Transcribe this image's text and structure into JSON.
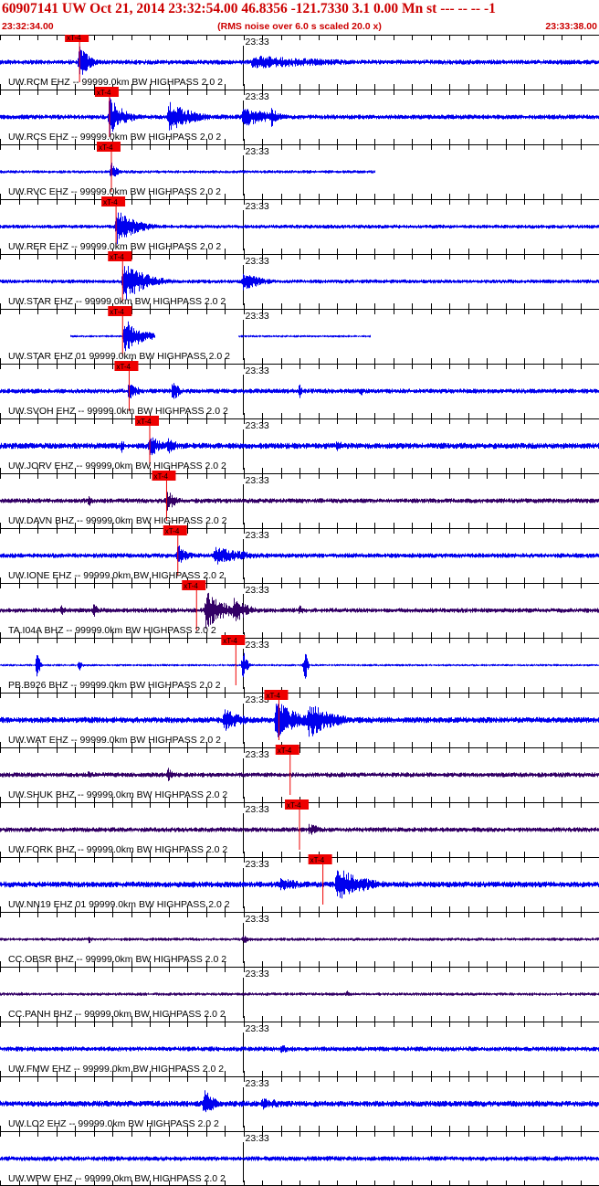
{
  "header": {
    "title": "60907141 UW Oct 21, 2014 23:32:54.00   46.8356 -121.7330  3.1 0.00 Mn st --- -- --   -1",
    "start_time": "23:32:34.00",
    "note": "(RMS noise over 6.0 s scaled 20.0 x)",
    "end_time": "23:33:38.00"
  },
  "colors": {
    "header_text": "#cc0000",
    "trace_blue": "#0000ee",
    "trace_purple": "#330066",
    "pick_red": "#ee0000",
    "grid": "#000000"
  },
  "chart_data": {
    "type": "line",
    "title": "60907141 UW Oct 21, 2014 23:32:54.00   46.8356 -121.7330  3.1 0.00 Mn st --- -- --   -1",
    "x_range": [
      "23:32:34.00",
      "23:33:38.00"
    ],
    "minute_label": "23:33",
    "minute_label_time": "23:33:00",
    "tick_interval_s": 2,
    "pick_label": "xT-4",
    "traces": [
      {
        "label": "UW.RCM EHZ -- 99999.0km BW  HIGHPASS  2.0  2",
        "color": "blue",
        "pick_s": 8.5,
        "bursts": [
          [
            8.5,
            1.0,
            0.9
          ],
          [
            27,
            10,
            0.35
          ]
        ],
        "noise": 0.12
      },
      {
        "label": "UW.RCS EHZ -- 99999.0km BW  HIGHPASS  2.0  2",
        "color": "blue",
        "pick_s": 11.7,
        "bursts": [
          [
            11.7,
            1.6,
            1.0
          ],
          [
            18,
            2.5,
            0.8
          ],
          [
            26,
            3.5,
            0.5
          ],
          [
            29,
            1.0,
            0.5
          ]
        ],
        "noise": 0.12
      },
      {
        "label": "UW.RVC EHZ -- 99999.0km BW  HIGHPASS  2.0  2",
        "color": "blue",
        "pick_s": 11.9,
        "bursts": [
          [
            11.9,
            0.6,
            0.5
          ]
        ],
        "noise": 0.08,
        "end_s": 40
      },
      {
        "label": "UW.RER EHZ -- 99999.0km BW  HIGHPASS  2.0  2",
        "color": "blue",
        "pick_s": 12.4,
        "bursts": [
          [
            12.5,
            2.0,
            0.9
          ]
        ],
        "noise": 0.1
      },
      {
        "label": "UW.STAR EHZ -- 99999.0km BW  HIGHPASS  2.0  2",
        "color": "blue",
        "pick_s": 13.1,
        "bursts": [
          [
            13.2,
            2.5,
            1.0
          ],
          [
            26,
            2.0,
            0.5
          ]
        ],
        "noise": 0.1
      },
      {
        "label": "UW.STAR EHZ 01 99999.0km BW  HIGHPASS  2.0  2",
        "color": "blue",
        "pick_s": 13.1,
        "bursts": [
          [
            13.3,
            1.8,
            0.9
          ]
        ],
        "noise": 0.06,
        "segments": [
          [
            7.5,
            16.5
          ],
          [
            25.5,
            39.5
          ]
        ]
      },
      {
        "label": "UW.SVOH EHZ -- 99999.0km BW  HIGHPASS  2.0  2",
        "color": "blue",
        "pick_s": 13.8,
        "bursts": [
          [
            13.8,
            1.0,
            0.5
          ],
          [
            18.5,
            0.6,
            0.6
          ],
          [
            32,
            0.4,
            0.35
          ],
          [
            38.5,
            0.4,
            0.3
          ]
        ],
        "noise": 0.12
      },
      {
        "label": "UW.JORV EHZ -- 99999.0km BW  HIGHPASS  2.0  2",
        "color": "blue",
        "pick_s": 16.0,
        "bursts": [
          [
            16.0,
            1.5,
            0.6
          ],
          [
            18,
            1.0,
            0.5
          ],
          [
            13,
            0.3,
            0.4
          ],
          [
            36,
            1.0,
            0.3
          ]
        ],
        "noise": 0.15
      },
      {
        "label": "UW.DAVN BHZ -- 99999.0km BW  HIGHPASS  2.0  2",
        "color": "purple",
        "pick_s": 17.8,
        "bursts": [
          [
            17.8,
            1.0,
            0.6
          ],
          [
            9.5,
            0.5,
            0.3
          ]
        ],
        "noise": 0.12
      },
      {
        "label": "UW.IONE EHZ -- 99999.0km BW  HIGHPASS  2.0  2",
        "color": "blue",
        "pick_s": 19.0,
        "bursts": [
          [
            19.0,
            1.0,
            0.6
          ],
          [
            23,
            3.5,
            0.5
          ]
        ],
        "noise": 0.12
      },
      {
        "label": "TA.I04A BHZ -- 99999.0km BW  HIGHPASS  2.0  2",
        "color": "purple",
        "pick_s": 21.0,
        "bursts": [
          [
            22.0,
            2.0,
            1.0
          ],
          [
            25,
            1.5,
            0.7
          ],
          [
            10,
            0.5,
            0.4
          ],
          [
            6.5,
            0.6,
            0.3
          ],
          [
            32,
            0.5,
            0.3
          ]
        ],
        "noise": 0.12
      },
      {
        "label": "PB.B926 BHZ -- 99999.0km BW  HIGHPASS  2.0  2",
        "color": "blue",
        "pick_s": 25.2,
        "bursts": [
          [
            26.0,
            0.3,
            1.0
          ],
          [
            4.0,
            0.2,
            0.9
          ],
          [
            32.6,
            0.2,
            0.9
          ],
          [
            8.5,
            0.3,
            0.3
          ]
        ],
        "noise": 0.06
      },
      {
        "label": "UW.WAT EHZ -- 99999.0km BW  HIGHPASS  2.0  2",
        "color": "blue",
        "pick_s": 29.8,
        "bursts": [
          [
            29.5,
            2.5,
            1.0
          ],
          [
            33,
            2.5,
            0.95
          ],
          [
            24,
            2.0,
            0.6
          ]
        ],
        "noise": 0.15
      },
      {
        "label": "UW.SHUK BHZ -- 99999.0km BW  HIGHPASS  2.0  2",
        "color": "purple",
        "pick_s": 31.0,
        "bursts": [
          [
            18.0,
            0.6,
            0.4
          ],
          [
            9.5,
            0.6,
            0.25
          ]
        ],
        "noise": 0.12
      },
      {
        "label": "UW.FORK BHZ -- 99999.0km BW  HIGHPASS  2.0  2",
        "color": "purple",
        "pick_s": 32.0,
        "bursts": [
          [
            33,
            2.0,
            0.3
          ]
        ],
        "noise": 0.12
      },
      {
        "label": "UW.NN19 EHZ 01 99999.0km BW  HIGHPASS  2.0  2",
        "color": "blue",
        "pick_s": 34.5,
        "bursts": [
          [
            36.0,
            3.0,
            0.9
          ],
          [
            30,
            3.0,
            0.35
          ],
          [
            20,
            4.0,
            0.2
          ]
        ],
        "noise": 0.15
      },
      {
        "label": "CC.OBSR BHZ -- 99999.0km BW  HIGHPASS  2.0  2",
        "color": "purple",
        "pick_s": null,
        "bursts": [
          [
            26,
            0.8,
            0.25
          ],
          [
            9.5,
            0.5,
            0.2
          ]
        ],
        "noise": 0.08
      },
      {
        "label": "CC.PANH BHZ -- 99999.0km BW  HIGHPASS  2.0  2",
        "color": "purple",
        "pick_s": null,
        "bursts": [
          [
            37,
            0.8,
            0.2
          ],
          [
            2,
            0.6,
            0.15
          ]
        ],
        "noise": 0.08
      },
      {
        "label": "UW.FMW EHZ -- 99999.0km BW  HIGHPASS  2.0  2",
        "color": "blue",
        "pick_s": null,
        "bursts": [
          [
            30,
            3.0,
            0.2
          ]
        ],
        "noise": 0.12
      },
      {
        "label": "UW.LO2 EHZ -- 99999.0km BW  HIGHPASS  2.0  2",
        "color": "blue",
        "pick_s": null,
        "bursts": [
          [
            21.8,
            1.0,
            0.8
          ],
          [
            28,
            4.0,
            0.3
          ]
        ],
        "noise": 0.15
      },
      {
        "label": "UW.WPW EHZ -- 99999.0km BW  HIGHPASS  2.0  2",
        "color": "blue",
        "pick_s": null,
        "bursts": [
          [
            35,
            3.0,
            0.15
          ]
        ],
        "noise": 0.12
      }
    ]
  }
}
